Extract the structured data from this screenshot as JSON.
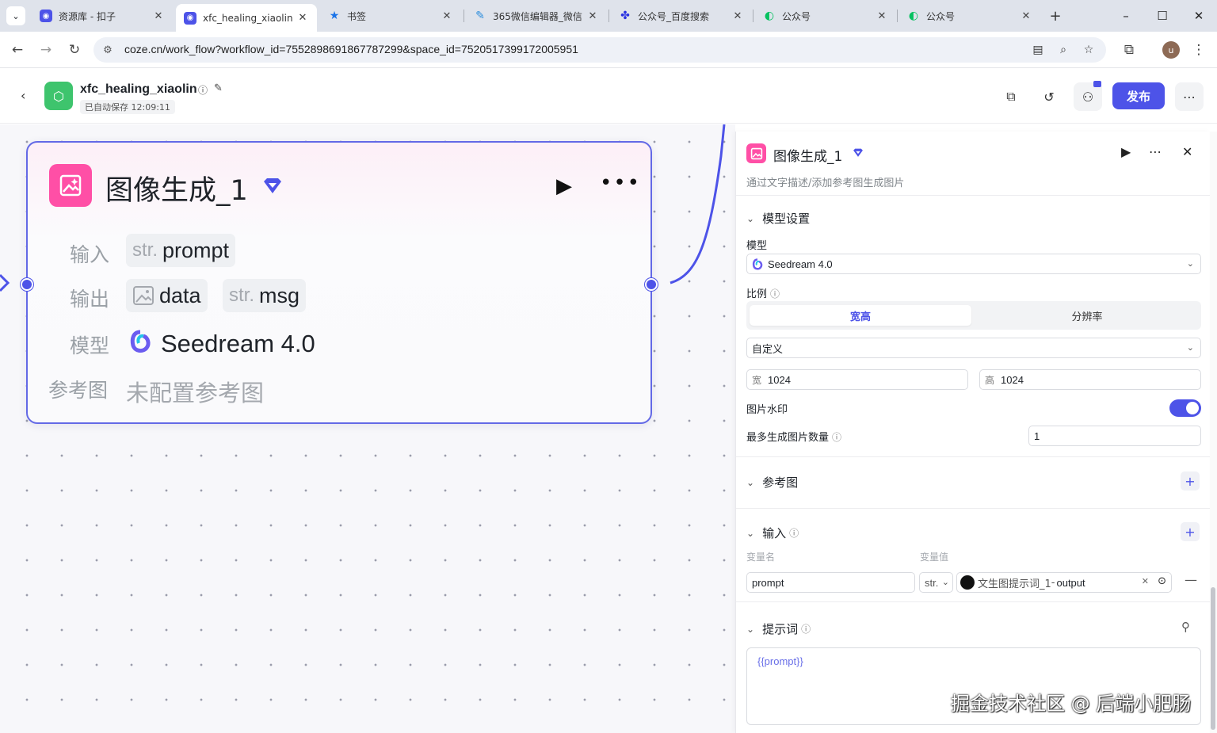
{
  "browser": {
    "tabs": [
      {
        "title": "资源库 - 扣子",
        "icon": "coze-icon",
        "color": "#4d53e8"
      },
      {
        "title": "xfc_healing_xiaolin",
        "icon": "coze-icon",
        "color": "#4d53e8",
        "active": true
      },
      {
        "title": "书签",
        "icon": "star-icon",
        "color": "#1a73e8"
      },
      {
        "title": "365微信编辑器_微信",
        "icon": "editor-icon",
        "color": "#2a8cdc"
      },
      {
        "title": "公众号_百度搜索",
        "icon": "baidu-icon",
        "color": "#2932e1"
      },
      {
        "title": "公众号",
        "icon": "wechat-icon",
        "color": "#07c160"
      },
      {
        "title": "公众号",
        "icon": "wechat-icon",
        "color": "#07c160"
      }
    ],
    "url": "coze.cn/work_flow?workflow_id=7552898691867787299&space_id=7520517399172005951",
    "profile_initial": "u"
  },
  "header": {
    "project_name": "xfc_healing_xiaolin",
    "autosave": "已自动保存 12:09:11",
    "publish_label": "发布"
  },
  "node": {
    "title": "图像生成_1",
    "input_label": "输入",
    "input_type": "str.",
    "input_name": "prompt",
    "output_label": "输出",
    "output_1_name": "data",
    "output_2_type": "str.",
    "output_2_name": "msg",
    "model_label": "模型",
    "model_value": "Seedream 4.0",
    "ref_label": "参考图",
    "ref_value": "未配置参考图"
  },
  "panel": {
    "title": "图像生成_1",
    "description": "通过文字描述/添加参考图生成图片",
    "model_section": "模型设置",
    "model_label": "模型",
    "model_value": "Seedream 4.0",
    "ratio_label": "比例",
    "ratio_options": [
      "宽高",
      "分辨率"
    ],
    "ratio_value": "自定义",
    "width_prefix": "宽",
    "width_value": "1024",
    "height_prefix": "高",
    "height_value": "1024",
    "watermark_label": "图片水印",
    "watermark_on": true,
    "max_images_label": "最多生成图片数量",
    "max_images_value": "1",
    "ref_section": "参考图",
    "input_section": "输入",
    "col_name": "变量名",
    "col_value": "变量值",
    "var_name": "prompt",
    "var_type": "str.",
    "ref_node": "文生图提示词_1",
    "ref_sep": " - ",
    "ref_output": "output",
    "prompt_section": "提示词",
    "prompt_text": "{{prompt}}"
  },
  "watermark": "掘金技术社区 @ 后端小肥肠",
  "colors": {
    "accent": "#4d53e8",
    "node_icon": "#ff4fa6",
    "project_logo": "#3ec46d"
  }
}
